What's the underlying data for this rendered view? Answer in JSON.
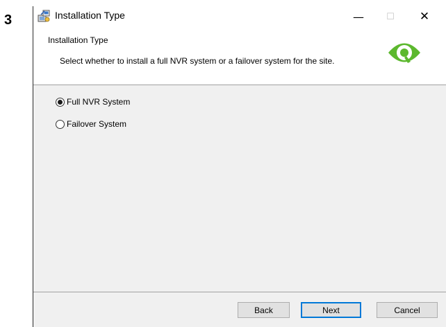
{
  "step": {
    "number": "3"
  },
  "window": {
    "title": "Installation Type",
    "controls": {
      "minimize": "—",
      "maximize": "☐",
      "close": "✕"
    }
  },
  "header": {
    "title": "Installation Type",
    "description": "Select whether to install a full NVR system or a failover system for the site.",
    "logo_icon": "eye-logo-icon",
    "brand_color": "#5cb82e"
  },
  "options": [
    {
      "label": "Full NVR System",
      "selected": true
    },
    {
      "label": "Failover System",
      "selected": false
    }
  ],
  "buttons": {
    "back": "Back",
    "next": "Next",
    "cancel": "Cancel"
  }
}
